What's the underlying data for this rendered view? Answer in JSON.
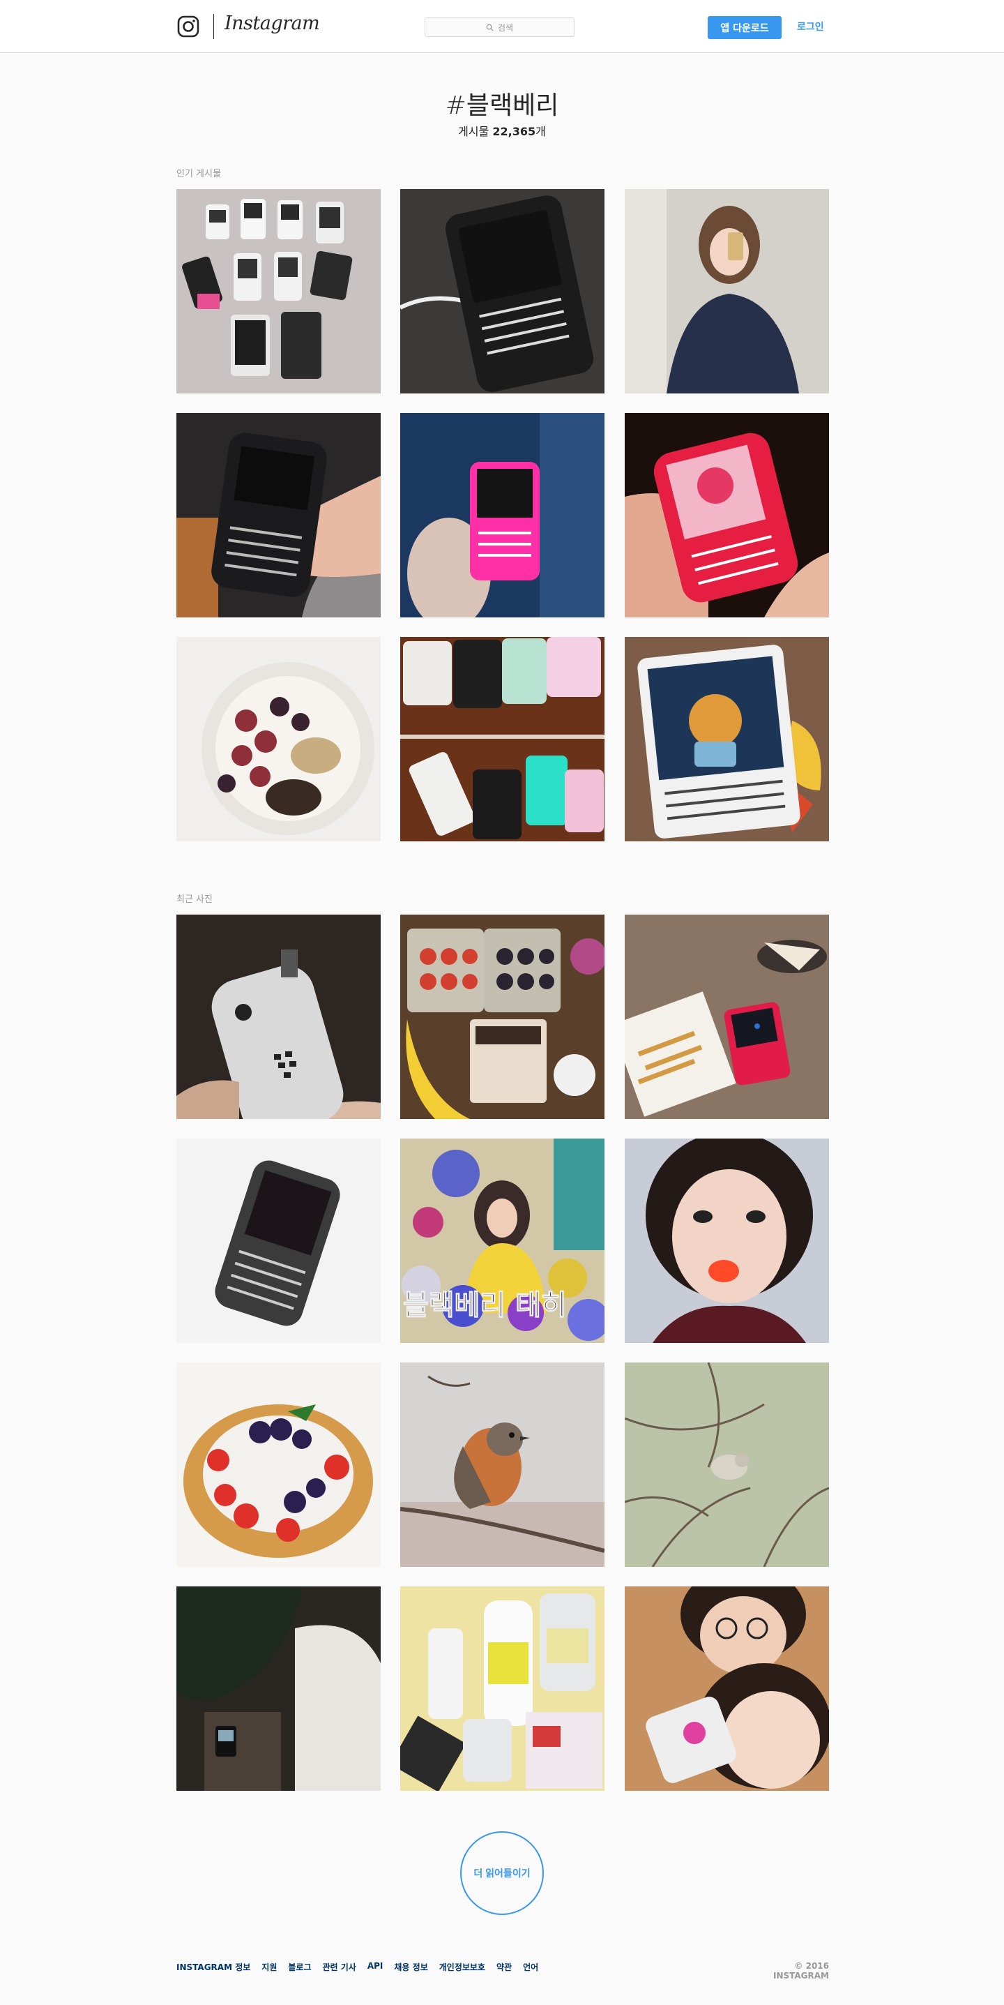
{
  "header": {
    "wordmark": "Instagram",
    "search_placeholder": "검색",
    "app_download": "앱 다운로드",
    "login": "로그인",
    "accent": "#3897f0"
  },
  "tag": {
    "title": "#블랙베리",
    "count_label": "게시물 ",
    "count": "22,365",
    "count_suffix": "개"
  },
  "top_posts": {
    "label": "인기 게시물",
    "tiles": [
      {
        "name": "multiple-phones-on-rug"
      },
      {
        "name": "blackberry-q10-charging"
      },
      {
        "name": "mirror-selfie"
      },
      {
        "name": "blackberry-bold-in-hand"
      },
      {
        "name": "pink-blackberry-q10"
      },
      {
        "name": "red-blackberry-q5"
      },
      {
        "name": "fruit-bowl"
      },
      {
        "name": "blackberry-collection-on-wood"
      },
      {
        "name": "blackberry-passport-character"
      }
    ]
  },
  "recent": {
    "label": "최근 사진",
    "tiles": [
      {
        "name": "white-blackberry-back"
      },
      {
        "name": "berries-and-yogurt"
      },
      {
        "name": "fries-and-phone"
      },
      {
        "name": "blackberry-classic-on-sheet",
        "text": ""
      },
      {
        "name": "girl-with-balloons",
        "text": "블랙베리 태히"
      },
      {
        "name": "lips-selfie"
      },
      {
        "name": "berry-waffle"
      },
      {
        "name": "robin-on-branch"
      },
      {
        "name": "bird-in-branches"
      },
      {
        "name": "dark-room-plant"
      },
      {
        "name": "cosmetics-bottles"
      },
      {
        "name": "couple-with-phone"
      }
    ]
  },
  "load_more": "더 읽어들이기",
  "footer": {
    "links": [
      "INSTAGRAM 정보",
      "지원",
      "블로그",
      "관련 기사",
      "API",
      "채용 정보",
      "개인정보보호",
      "약관",
      "언어"
    ],
    "copyright": "© 2016 INSTAGRAM"
  }
}
